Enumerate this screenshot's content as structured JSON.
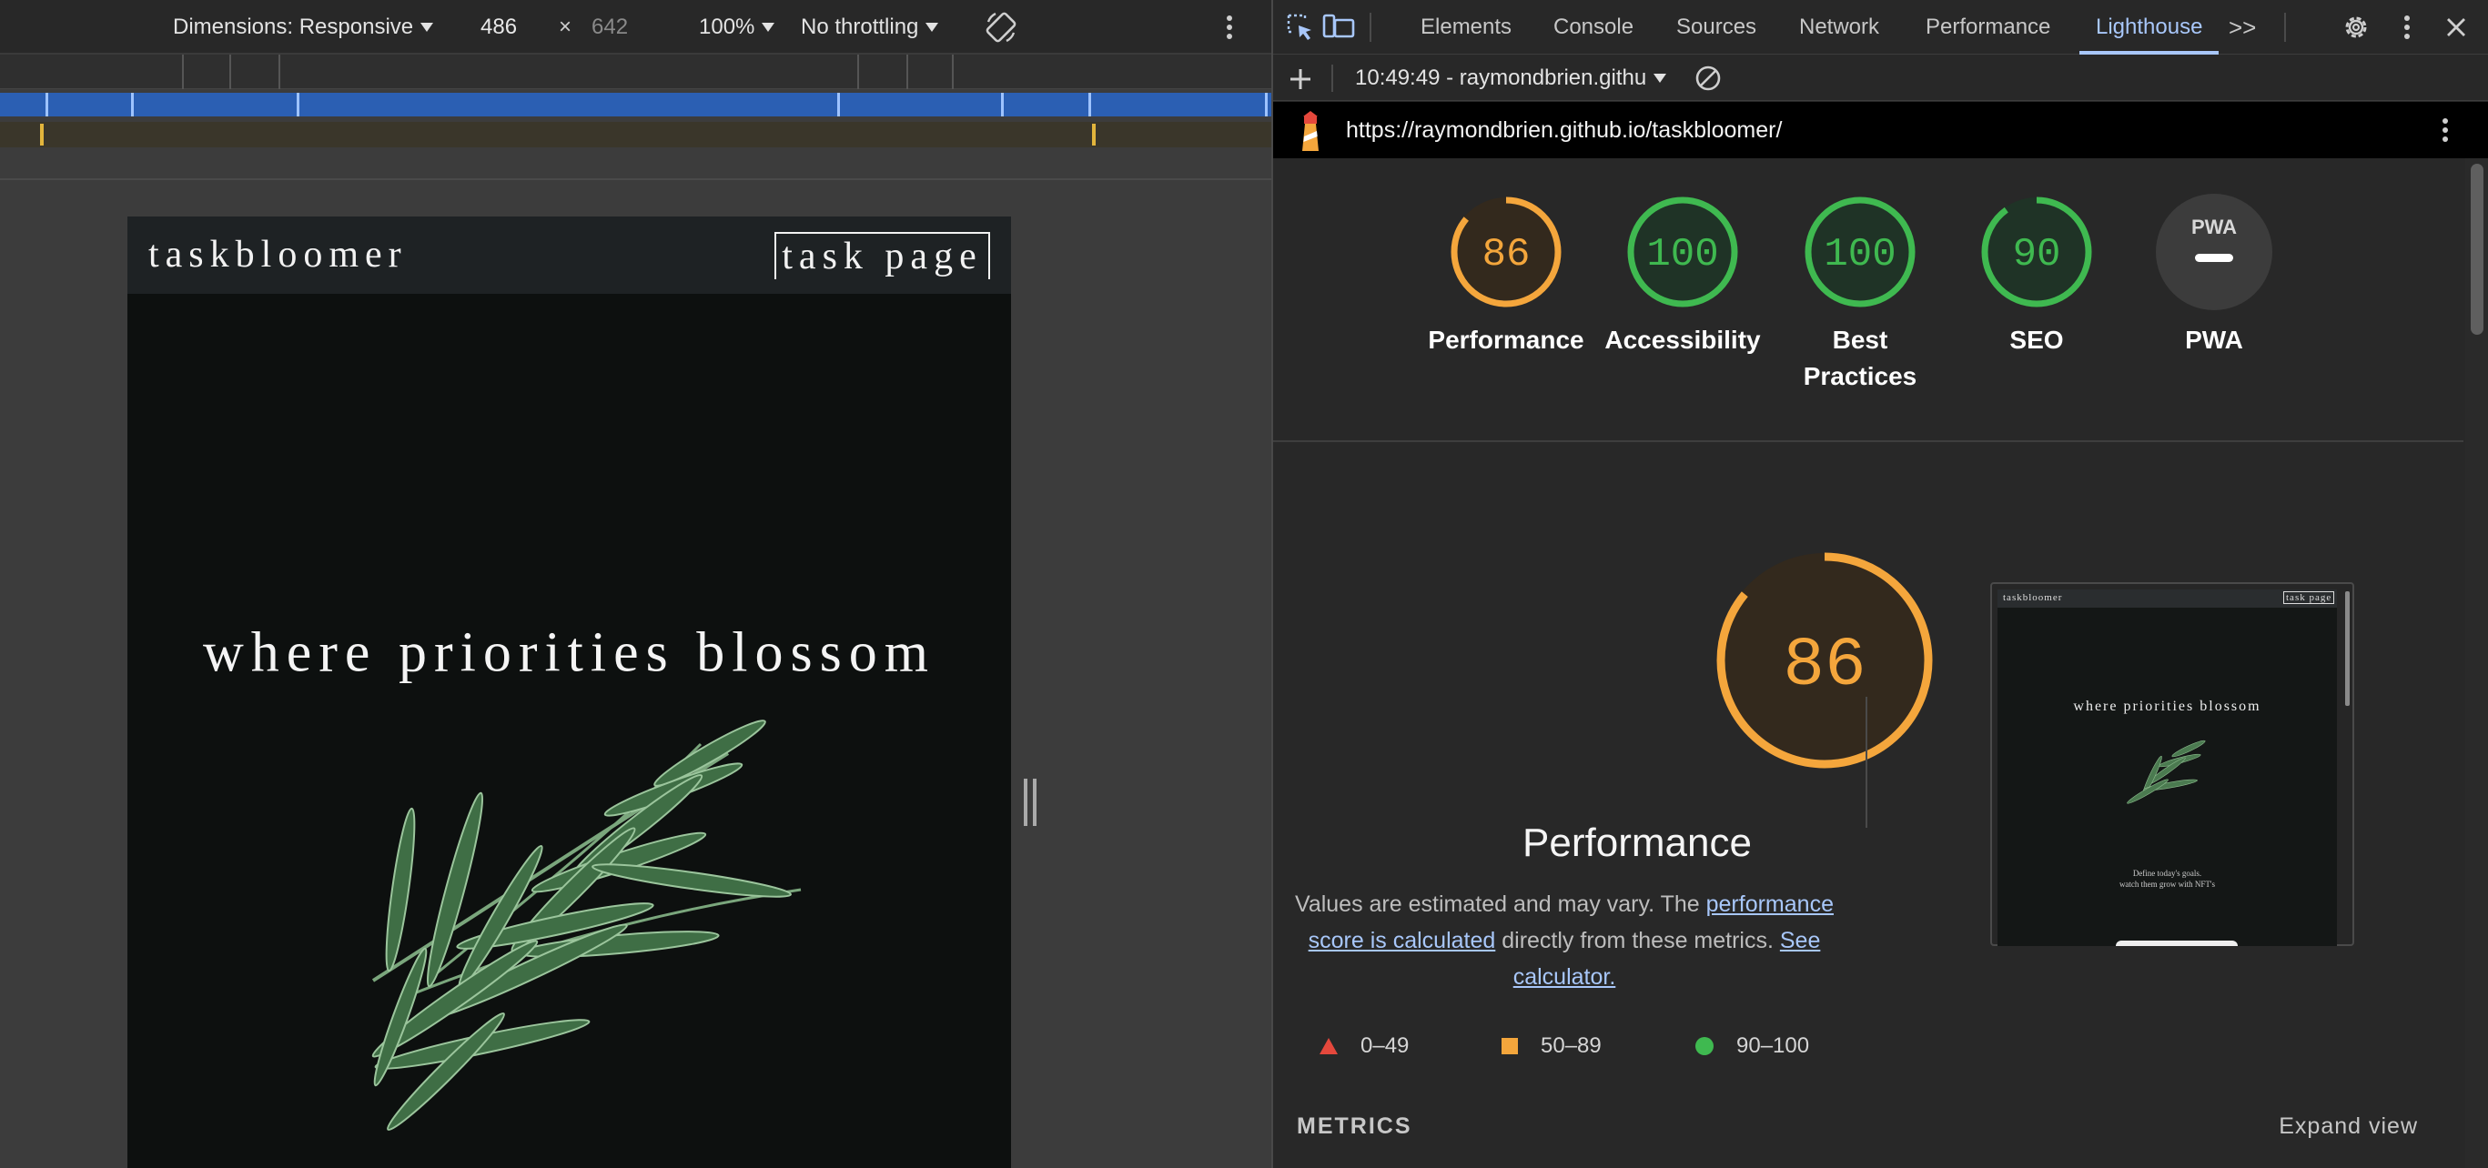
{
  "device_toolbar": {
    "dimensions_label": "Dimensions: Responsive",
    "width_value": "486",
    "times_sign": "×",
    "height_value": "642",
    "zoom": "100%",
    "throttling": "No throttling"
  },
  "emulated_page": {
    "logo": "taskbloomer",
    "nav_link": "task page",
    "hero_text": "where priorities blossom"
  },
  "devtools_tabs": [
    "Elements",
    "Console",
    "Sources",
    "Network",
    "Performance",
    "Lighthouse"
  ],
  "active_tab": "Lighthouse",
  "more_tabs_label": ">>",
  "lighthouse_toolbar": {
    "report_select": "10:49:49 - raymondbrien.githu"
  },
  "report_url": "https://raymondbrien.github.io/taskbloomer/",
  "scores": [
    {
      "label": "Performance",
      "value": 86,
      "display": "86",
      "color": "#f4a63c"
    },
    {
      "label": "Accessibility",
      "value": 100,
      "display": "100",
      "color": "#3fb950"
    },
    {
      "label": "Best Practices",
      "value": 100,
      "display": "100",
      "color": "#3fb950"
    },
    {
      "label": "SEO",
      "value": 90,
      "display": "90",
      "color": "#3fb950"
    },
    {
      "label": "PWA",
      "value": null,
      "display": "PWA",
      "color": "#9e9e9e"
    }
  ],
  "performance_detail": {
    "score": "86",
    "title": "Performance",
    "desc_prefix": "Values are estimated and may vary. The ",
    "link1": "performance score is calculated",
    "desc_middle": " directly from these metrics. ",
    "link2": "See calculator."
  },
  "legend": [
    {
      "range": "0–49",
      "shape": "triangle",
      "color": "#e5483c"
    },
    {
      "range": "50–89",
      "shape": "square",
      "color": "#f4a63c"
    },
    {
      "range": "90–100",
      "shape": "circle",
      "color": "#3fb950"
    }
  ],
  "metrics_label": "METRICS",
  "expand_view": "Expand view",
  "thumbnail": {
    "logo": "taskbloomer",
    "nav": "task page",
    "hero": "where priorities blossom",
    "tagline_line1": "Define today's goals.",
    "tagline_line2": "watch them grow with NFT's"
  }
}
